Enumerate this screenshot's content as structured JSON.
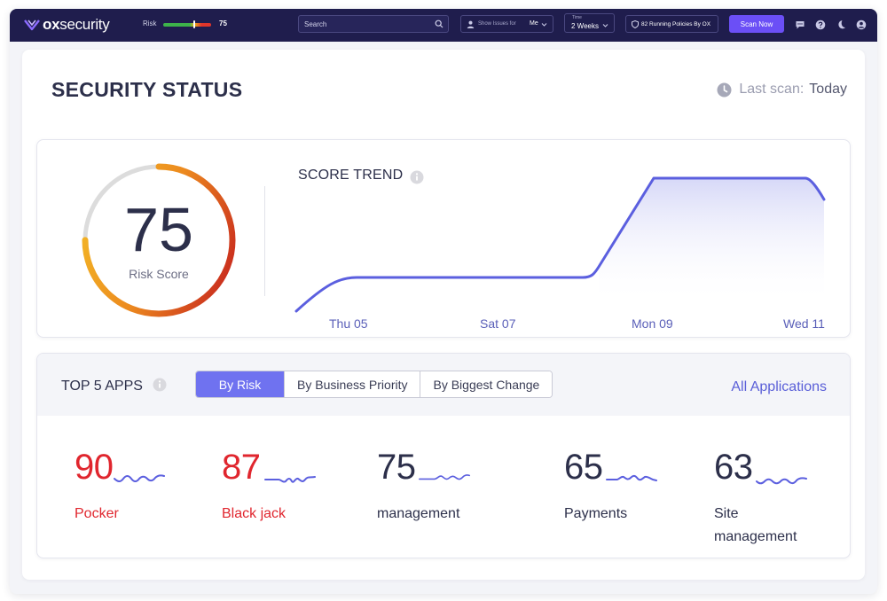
{
  "topbar": {
    "logo": {
      "strong": "ox",
      "light": "security"
    },
    "risk_label": "Risk",
    "risk_value": "75",
    "risk_fraction": 0.75,
    "search_placeholder": "Search",
    "issues_label": "Show Issues for",
    "issues_value": "Me",
    "time_label": "Time",
    "time_value": "2 Weeks",
    "policies_text": "82 Running Policies By OX",
    "scan_button": "Scan Now",
    "icons": [
      "chat-icon",
      "help-icon",
      "moon-icon",
      "account-icon"
    ],
    "colors": {
      "bar": "#1f1d4d",
      "accent": "#6b4ff6"
    }
  },
  "header": {
    "title": "SECURITY STATUS",
    "last_scan_label": "Last scan:",
    "last_scan_value": "Today"
  },
  "score": {
    "value": "75",
    "label": "Risk Score",
    "fraction": 0.75
  },
  "trend": {
    "title": "SCORE TREND",
    "chart_data": {
      "type": "area",
      "x_labels": [
        "Thu 05",
        "Sat 07",
        "Mon 09",
        "Wed 11"
      ],
      "color": "#5b5fdf"
    }
  },
  "apps": {
    "title": "TOP 5 APPS",
    "tabs": [
      {
        "label": "By Risk",
        "active": true
      },
      {
        "label": "By Business Priority",
        "active": false
      },
      {
        "label": "By Biggest Change",
        "active": false
      }
    ],
    "all_link": "All Applications",
    "items": [
      {
        "score": "90",
        "name": "Pocker",
        "color": "#e0262e"
      },
      {
        "score": "87",
        "name": "Black jack",
        "color": "#e0262e"
      },
      {
        "score": "75",
        "name": "management",
        "color": "#2c2f4a"
      },
      {
        "score": "65",
        "name": "Payments",
        "color": "#2c2f4a"
      },
      {
        "score": "63",
        "name": "Site management",
        "color": "#2c2f4a"
      }
    ]
  }
}
